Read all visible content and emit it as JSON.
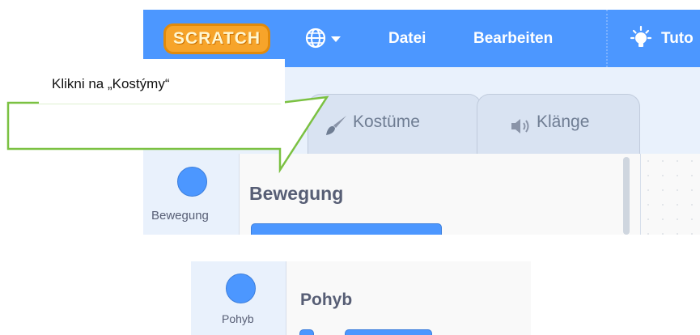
{
  "menubar": {
    "logo_text": "SCRATCH",
    "items": [
      "Datei",
      "Bearbeiten"
    ],
    "tutorials_label": "Tuto",
    "icons": [
      "globe-icon",
      "chevron-down-icon",
      "lightbulb-icon"
    ],
    "color": "#4c97ff"
  },
  "tabs": [
    {
      "label": "Kostüme",
      "icon": "brush-icon"
    },
    {
      "label": "Klänge",
      "icon": "speaker-icon"
    }
  ],
  "callout": {
    "text": "Klikni na „Kostýmy“",
    "border_color": "#7bc142"
  },
  "workspace_top": {
    "category_label": "Bewegung",
    "palette_title": "Bewegung",
    "category_color": "#4c97ff"
  },
  "workspace_bottom": {
    "category_label": "Pohyb",
    "palette_title": "Pohyb"
  }
}
